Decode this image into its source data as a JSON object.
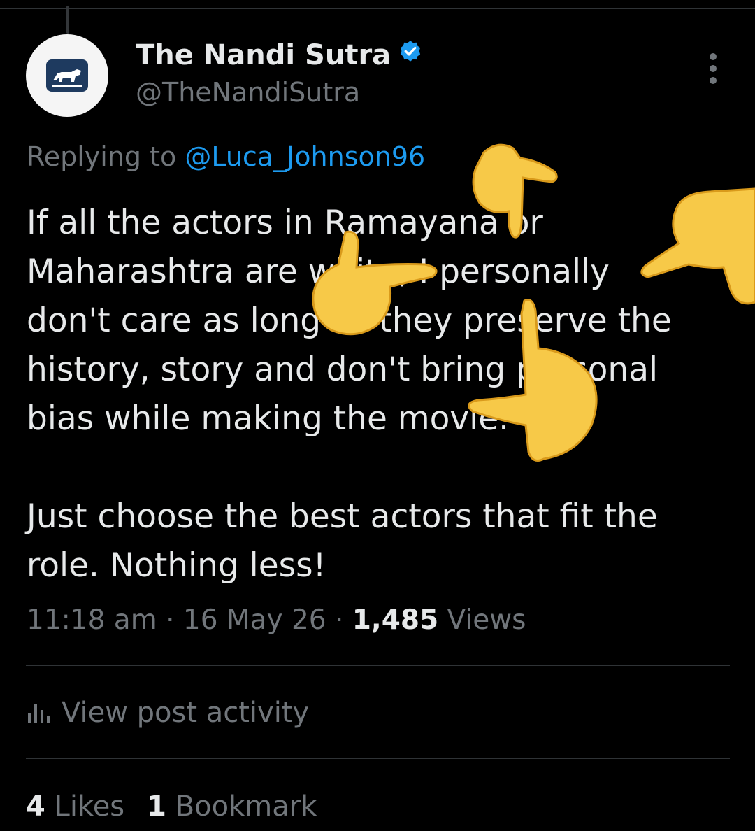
{
  "author": {
    "display_name": "The Nandi Sutra",
    "handle": "@TheNandiSutra",
    "verified_icon": "verified-badge-icon",
    "avatar_icon": "bull-logo-icon"
  },
  "reply": {
    "prefix": "Replying to ",
    "mention": "@Luca_Johnson96"
  },
  "tweet": {
    "paragraph1": [
      "If all the actors in Ramayana or",
      "Maharashtra are white, I personally",
      "don't care as long as they preserve the",
      "history, story and don't bring personal",
      "bias while making the movie."
    ],
    "paragraph2": [
      "Just choose the best actors that fit the",
      "role. Nothing less!"
    ]
  },
  "meta": {
    "time": "11:18 am",
    "sep": " · ",
    "date": "16 May 26",
    "views_count": "1,485",
    "views_label": " Views"
  },
  "activity": {
    "label": "View post activity",
    "icon": "bar-chart-icon"
  },
  "stats": {
    "likes_count": "4",
    "likes_label": " Likes",
    "bookmarks_count": "1",
    "bookmarks_label": " Bookmark"
  },
  "overlay": {
    "emoji_icon": "pointing-hand-emoji-icon",
    "count": 4
  },
  "colors": {
    "background": "#000000",
    "text": "#e7e9ea",
    "secondary": "#71767b",
    "link": "#1d9bf0",
    "divider": "#2f3336",
    "emoji": "#f7c948"
  }
}
